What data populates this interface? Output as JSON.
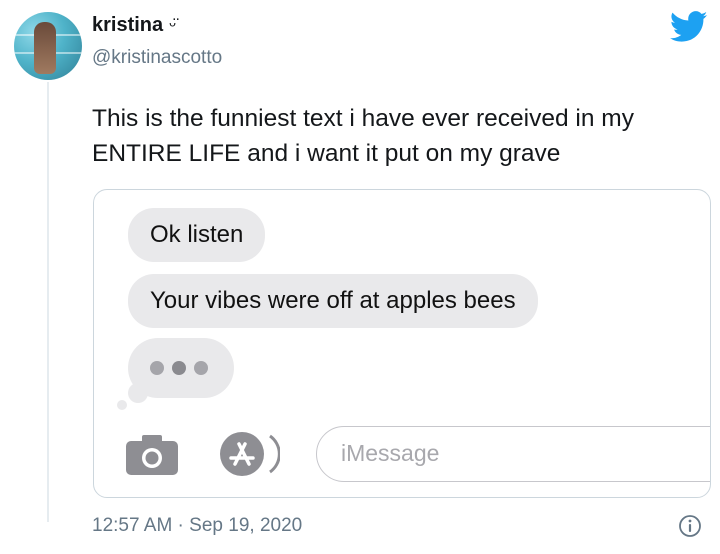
{
  "tweet": {
    "display_name": "kristina",
    "name_emoji": "ᵕ̈",
    "handle": "@kristinascotto",
    "text": "This is the funniest text i have ever received in my ENTIRE LIFE and i want it put on my grave",
    "timestamp": "12:57 AM · Sep 19, 2020"
  },
  "screenshot": {
    "messages": [
      {
        "text": "Ok listen"
      },
      {
        "text": "Your vibes were off at apples bees"
      }
    ],
    "typing_indicator": "•••",
    "input_placeholder": "iMessage"
  },
  "icons": {
    "avatar": "profile-photo",
    "brand": "twitter-bird-icon",
    "camera": "camera-icon",
    "appstore": "app-store-icon",
    "info": "info-icon"
  },
  "colors": {
    "twitter_blue": "#1da1f2",
    "bubble_gray": "#e9e9eb",
    "secondary_text": "#657786"
  }
}
